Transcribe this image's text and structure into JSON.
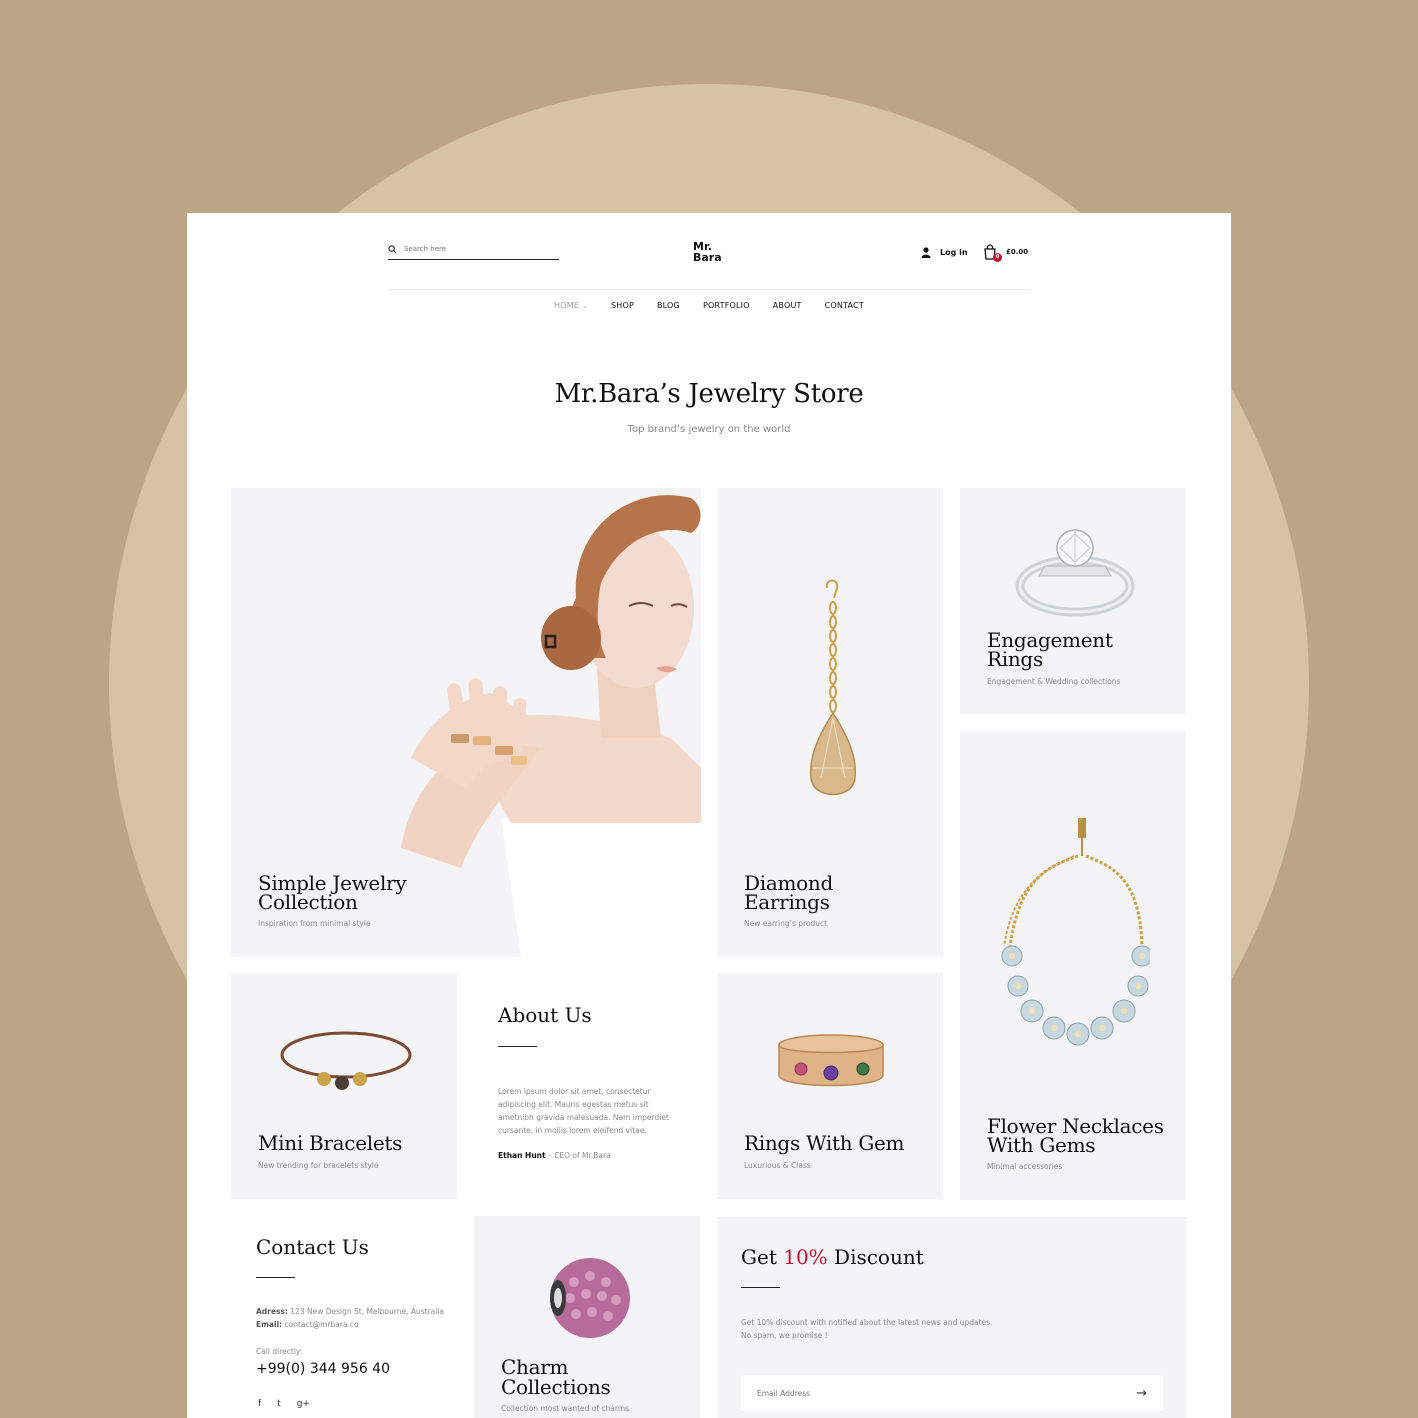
{
  "header": {
    "search_placeholder": "Search here",
    "logo_line1": "Mr.",
    "logo_line2": "Bara",
    "login_label": "Log in",
    "cart_count": "0",
    "cart_total": "£0.00"
  },
  "nav": {
    "home": "HOME",
    "shop": "SHOP",
    "blog": "BLOG",
    "portfolio": "PORTFOLIO",
    "about": "ABOUT",
    "contact": "CONTACT"
  },
  "hero": {
    "title": "Mr.Bara’s Jewelry Store",
    "subtitle": "Top brand’s jewelry on the world"
  },
  "tiles": {
    "simple": {
      "title1": "Simple Jewelry",
      "title2": "Collection",
      "sub": "Inspiration from minimal style"
    },
    "earrings": {
      "title1": "Diamond",
      "title2": "Earrings",
      "sub": "New earring’s product"
    },
    "rings": {
      "title1": "Engagement",
      "title2": "Rings",
      "sub": "Engagement & Wedding collections"
    },
    "necklaces": {
      "title1": "Flower Necklaces",
      "title2": "With Gems",
      "sub": "Minimal accessories"
    },
    "bracelets": {
      "title": "Mini Bracelets",
      "sub": "New trending for bracelets style"
    },
    "gem_rings": {
      "title": "Rings With Gem",
      "sub": "Luxurious & Class"
    },
    "charm": {
      "title1": "Charm",
      "title2": "Collections",
      "sub": "Collection most wanted of charms"
    }
  },
  "about": {
    "title": "About Us",
    "body": "Lorem ipsum dolor sit amet, consectetur adipiscing elit. Mauris egestas metus sit ametnibh gravida malesuada. Nam imperdiet cursante, in mollis lorem eleifend vitae.",
    "author": "Ethan Hunt",
    "role": " – CEO of Mr.Bara"
  },
  "contact": {
    "title": "Contact Us",
    "address_label": "Adress:",
    "address": " 123 New Design St, Melbourne, Australia",
    "email_label": "Email:",
    "email": " contact@mrbara.co",
    "call_label": "Call directly:",
    "phone": "+99(0) 344 956 40",
    "social": [
      "f",
      "t",
      "g+"
    ]
  },
  "discount": {
    "title_pre": "Get ",
    "title_highlight": "10%",
    "title_post": " Discount",
    "line1": "Get 10% discount with notified about the latest news and updates.",
    "line2": "No spam, we promise !",
    "email_placeholder": "Email Address"
  },
  "colors": {
    "outer_bg": "#bba584",
    "circle": "#d6c3a4",
    "tile_bg": "#f4f4f6",
    "accent_red": "#c8102e"
  }
}
